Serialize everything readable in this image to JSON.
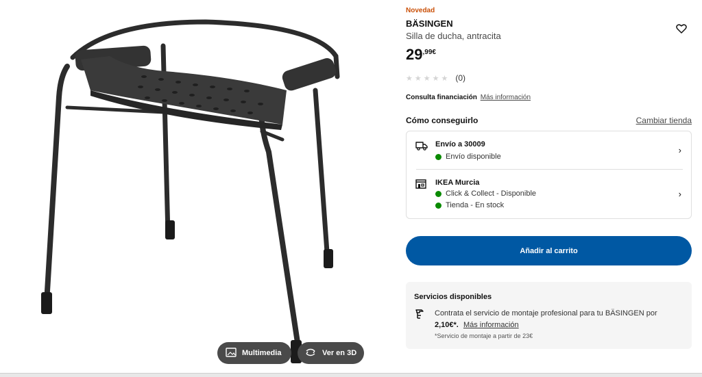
{
  "product": {
    "badge": "Novedad",
    "name": "BÄSINGEN",
    "description": "Silla de ducha, antracita",
    "price_integer": "29",
    "price_decimal": ",99€",
    "rating_count": "(0)",
    "rating_value": 0,
    "rating_max": 5
  },
  "financing": {
    "label": "Consulta financiación",
    "link": "Más información"
  },
  "availability": {
    "heading": "Cómo conseguirlo",
    "change_store": "Cambiar tienda",
    "delivery": {
      "title": "Envío a 30009",
      "status": "Envío disponible",
      "icon": "truck-icon"
    },
    "store": {
      "title": "IKEA Murcia",
      "status1": "Click & Collect - Disponible",
      "status2": "Tienda - En stock",
      "icon": "store-icon"
    },
    "status_color": "#0a8a00"
  },
  "cart": {
    "button": "Añadir al carrito",
    "color": "#0058a3"
  },
  "services": {
    "title": "Servicios disponibles",
    "text": "Contrata el servicio de montaje profesional para tu BÄSINGEN por",
    "price": "2,10€*.",
    "link": "Más información",
    "note": "*Servicio de montaje a partir de 23€",
    "icon": "assembly-icon"
  },
  "media": {
    "multimedia": "Multimedia",
    "view3d": "Ver en 3D"
  }
}
